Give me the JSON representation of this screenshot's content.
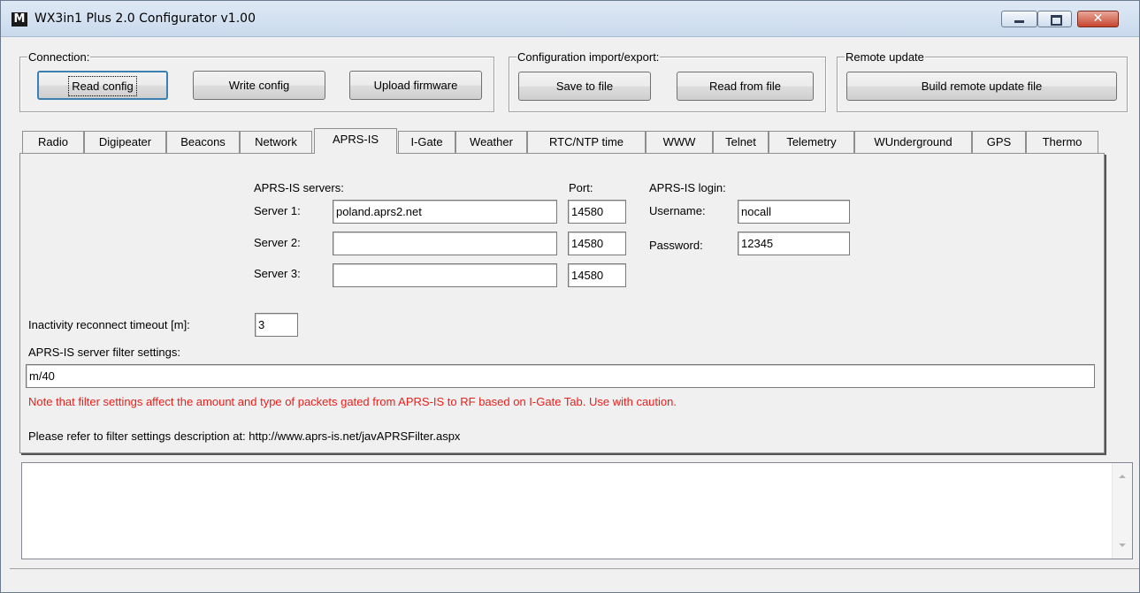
{
  "window": {
    "title": "WX3in1 Plus 2.0 Configurator v1.00",
    "icon_letter": "M",
    "close_glyph": "✕"
  },
  "connection": {
    "legend": "Connection:",
    "read_label": "Read config",
    "write_label": "Write config",
    "upload_label": "Upload firmware"
  },
  "import_export": {
    "legend": "Configuration import/export:",
    "save_label": "Save to file",
    "read_label": "Read from file"
  },
  "remote_update": {
    "legend": "Remote update",
    "build_label": "Build remote update file"
  },
  "tabs": [
    {
      "label": "Radio"
    },
    {
      "label": "Digipeater"
    },
    {
      "label": "Beacons"
    },
    {
      "label": "Network"
    },
    {
      "label": "APRS-IS"
    },
    {
      "label": "I-Gate"
    },
    {
      "label": "Weather"
    },
    {
      "label": "RTC/NTP time"
    },
    {
      "label": "WWW"
    },
    {
      "label": "Telnet"
    },
    {
      "label": "Telemetry"
    },
    {
      "label": "WUnderground"
    },
    {
      "label": "GPS"
    },
    {
      "label": "Thermo"
    }
  ],
  "active_tab": "APRS-IS",
  "aprs_is": {
    "servers_heading": "APRS-IS servers:",
    "port_heading": "Port:",
    "login_heading": "APRS-IS login:",
    "server1_label": "Server 1:",
    "server2_label": "Server 2:",
    "server3_label": "Server 3:",
    "server1_value": "poland.aprs2.net",
    "server2_value": "",
    "server3_value": "",
    "port1_value": "14580",
    "port2_value": "14580",
    "port3_value": "14580",
    "username_label": "Username:",
    "username_value": "nocall",
    "password_label": "Password:",
    "password_value": "12345",
    "timeout_label": "Inactivity reconnect timeout [m]:",
    "timeout_value": "3",
    "filter_label": "APRS-IS server filter settings:",
    "filter_value": "m/40",
    "warning_note": "Note that filter settings affect the amount and type of packets gated from APRS-IS to RF based on I-Gate Tab. Use with caution.",
    "refer_note": "Please refer to filter settings description at: http://www.aprs-is.net/javAPRSFilter.aspx"
  },
  "log": {
    "content": ""
  },
  "status": {
    "text": ""
  },
  "colors": {
    "warning": "#e8201c",
    "default_button_border": "#3c7fb1"
  }
}
